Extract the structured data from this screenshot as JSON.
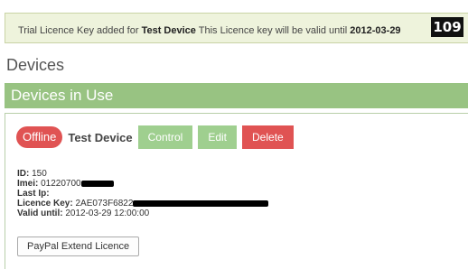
{
  "notice": {
    "prefix": "Trial Licence Key added for ",
    "device": "Test Device",
    "middle": " This Licence key will be valid until ",
    "date": "2012-03-29",
    "badge": "109"
  },
  "page": {
    "title": "Devices"
  },
  "section": {
    "title": "Devices in Use"
  },
  "device": {
    "status": "Offline",
    "name": "Test Device",
    "buttons": {
      "control": "Control",
      "edit": "Edit",
      "delete": "Delete"
    },
    "details": {
      "id_label": "ID:",
      "id_value": "150",
      "imei_label": "Imei:",
      "imei_value": "01220700",
      "lastip_label": "Last Ip:",
      "key_label": "Licence Key:",
      "key_value": "2AE073F6822",
      "valid_label": "Valid until:",
      "valid_value": "2012-03-29 12:00:00"
    },
    "paypal_label": "PayPal Extend Licence"
  },
  "colors": {
    "notice_bg": "#eef3dc",
    "section_bg": "#98c382",
    "status_offline": "#e05353",
    "btn_green": "#9fcf8f",
    "btn_delete": "#e05353"
  }
}
